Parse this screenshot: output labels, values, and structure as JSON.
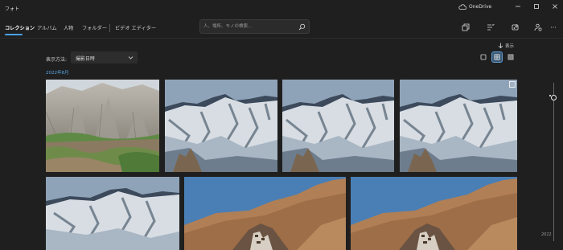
{
  "titlebar": {
    "app_title": "フォト",
    "onedrive_label": "OneDrive"
  },
  "nav": {
    "items": [
      {
        "label": "コレクション",
        "active": true
      },
      {
        "label": "アルバム"
      },
      {
        "label": "人物"
      },
      {
        "label": "フォルダー"
      },
      {
        "label": "ビデオ エディター"
      }
    ]
  },
  "search": {
    "placeholder": "人、場所、モノの検索..."
  },
  "toolbar": {
    "more_label": "···"
  },
  "sort": {
    "label": "表示方法:",
    "value": "撮影日時"
  },
  "view": {
    "label": "表示"
  },
  "gallery": {
    "date_header": "2022年8月"
  },
  "timeline": {
    "year": "2022"
  },
  "colors": {
    "accent": "#4aa0e6",
    "background": "#1f1f1f"
  }
}
